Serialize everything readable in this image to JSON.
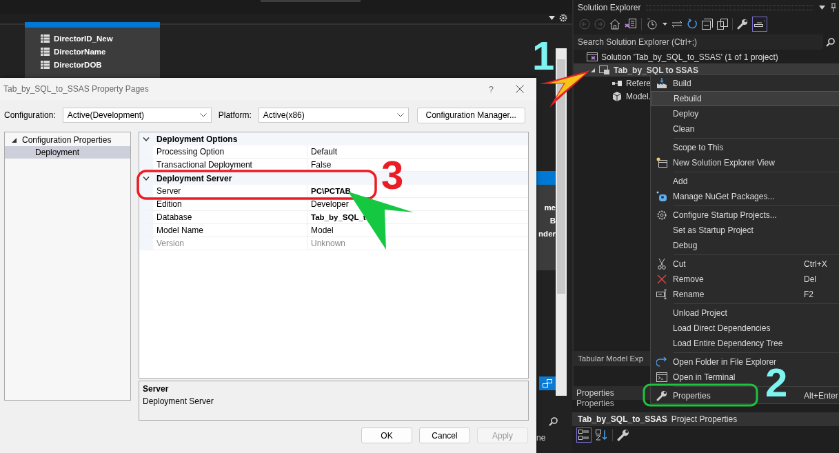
{
  "editor": {
    "table_fields": [
      "DirectorID_New",
      "DirectorName",
      "DirectorDOB"
    ],
    "partial_labels": [
      "me",
      "B",
      "nder"
    ],
    "bottom_fragment": "ne"
  },
  "dialog": {
    "title": "Tab_by_SQL_to_SSAS Property Pages",
    "help": "?",
    "configuration": {
      "label": "Configuration:",
      "value": "Active(Development)"
    },
    "platform": {
      "label": "Platform:",
      "value": "Active(x86)"
    },
    "config_manager_button": "Configuration Manager...",
    "tree": [
      {
        "label": "Configuration Properties",
        "expanded": true,
        "selected": false,
        "children": [
          {
            "label": "Deployment",
            "selected": true
          }
        ]
      }
    ],
    "property_grid": [
      {
        "category": "Deployment Options",
        "expanded": true,
        "properties": [
          {
            "name": "Processing Option",
            "value": "Default",
            "bold": false,
            "disabled": false
          },
          {
            "name": "Transactional Deployment",
            "value": "False",
            "bold": false,
            "disabled": false
          }
        ]
      },
      {
        "category": "Deployment Server",
        "expanded": true,
        "properties": [
          {
            "name": "Server",
            "value": "PC\\PCTAB",
            "bold": true,
            "disabled": false
          },
          {
            "name": "Edition",
            "value": "Developer",
            "bold": false,
            "disabled": false
          },
          {
            "name": "Database",
            "value": "Tab_by_SQL_t",
            "bold": true,
            "disabled": false
          },
          {
            "name": "Model Name",
            "value": "Model",
            "bold": false,
            "disabled": false
          },
          {
            "name": "Version",
            "value": "Unknown",
            "bold": false,
            "disabled": true
          }
        ]
      }
    ],
    "description": {
      "title": "Server",
      "text": "Deployment Server"
    },
    "buttons": [
      {
        "label": "OK",
        "disabled": false
      },
      {
        "label": "Cancel",
        "disabled": false
      },
      {
        "label": "Apply",
        "disabled": true
      }
    ]
  },
  "solution_explorer": {
    "title": "Solution Explorer",
    "search": {
      "placeholder": "Search Solution Explorer (Ctrl+;)"
    },
    "tree": [
      {
        "label": "Solution 'Tab_by_SQL_to_SSAS' (1 of 1 project)",
        "selected": false,
        "children": [
          {
            "label": "Tab_by_SQL to SSAS",
            "selected": true,
            "expanded": true,
            "children": [
              {
                "label": "Refere",
                "selected": false
              },
              {
                "label": "Model.",
                "selected": false
              }
            ]
          }
        ]
      }
    ],
    "bottom_tab": "Tabular Model Exp"
  },
  "context_menu": {
    "groups": [
      [
        {
          "label": "Build",
          "selected": false
        },
        {
          "label": "Rebuild",
          "selected": true
        },
        {
          "label": "Deploy",
          "selected": false
        },
        {
          "label": "Clean",
          "selected": false
        }
      ],
      [
        {
          "label": "Scope to This",
          "selected": false
        },
        {
          "label": "New Solution Explorer View",
          "selected": false
        }
      ],
      [
        {
          "label": "Add",
          "selected": false
        },
        {
          "label": "Manage NuGet Packages...",
          "selected": false
        }
      ],
      [
        {
          "label": "Configure Startup Projects...",
          "selected": false
        },
        {
          "label": "Set as Startup Project",
          "selected": false
        },
        {
          "label": "Debug",
          "selected": false
        }
      ],
      [
        {
          "label": "Cut",
          "shortcut": "Ctrl+X",
          "selected": false
        },
        {
          "label": "Remove",
          "shortcut": "Del",
          "selected": false
        },
        {
          "label": "Rename",
          "shortcut": "F2",
          "selected": false
        }
      ],
      [
        {
          "label": "Unload Project",
          "selected": false
        },
        {
          "label": "Load Direct Dependencies",
          "selected": false
        },
        {
          "label": "Load Entire Dependency Tree",
          "selected": false
        }
      ],
      [
        {
          "label": "Open Folder in File Explorer",
          "selected": false
        },
        {
          "label": "Open in Terminal",
          "selected": false
        }
      ],
      [
        {
          "label": "Properties",
          "shortcut": "Alt+Enter",
          "selected": false
        }
      ]
    ]
  },
  "properties_panel": {
    "title": "Properties",
    "subtitle": "Properties",
    "object_name": "Tab_by_SQL_to_SSAS",
    "object_type": "Project Properties"
  },
  "annotations": [
    {
      "label": "1",
      "color": "#7ef4f2"
    },
    {
      "label": "2",
      "color": "#7ef4f2"
    },
    {
      "label": "3",
      "color": "#ec1c24"
    }
  ]
}
